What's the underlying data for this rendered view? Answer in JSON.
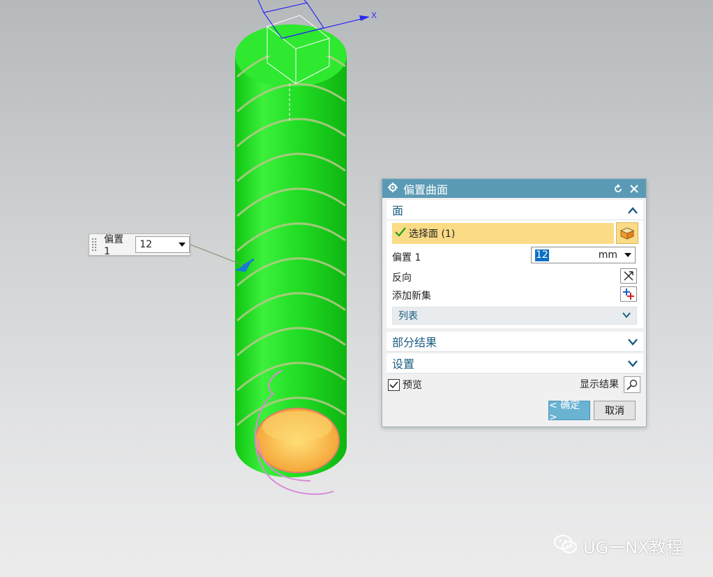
{
  "viewport": {
    "axis_x_label": "X",
    "colors": {
      "cylinder": "#1ee021",
      "inner_face": "#f7b83a",
      "helix": "#d98ad6",
      "handle": "#1a78d6"
    }
  },
  "onscreen_input": {
    "label": "偏置 1",
    "value": "12"
  },
  "dialog": {
    "title": "偏置曲面",
    "sections": {
      "face": {
        "header": "面",
        "select_face": "选择面 (1)",
        "offset_label": "偏置 1",
        "offset_value": "12",
        "offset_unit": "mm",
        "reverse_label": "反向",
        "add_set_label": "添加新集",
        "list_label": "列表"
      },
      "partial_results": {
        "header": "部分结果"
      },
      "settings": {
        "header": "设置"
      }
    },
    "preview_label": "预览",
    "preview_checked": true,
    "show_result_label": "显示结果",
    "ok_label": "< 确定 >",
    "cancel_label": "取消"
  },
  "watermark": {
    "text": "UG一NX教程"
  }
}
